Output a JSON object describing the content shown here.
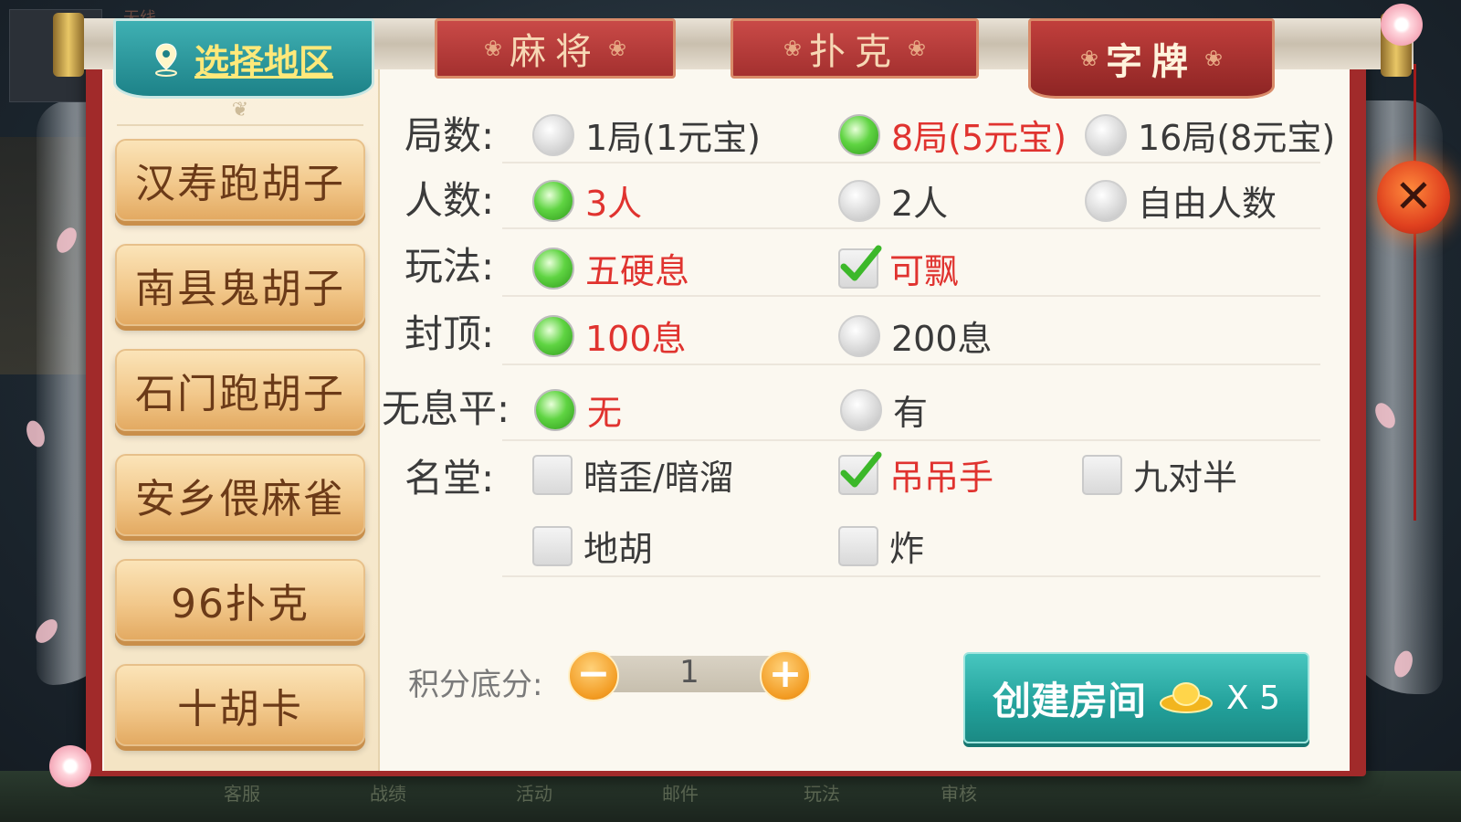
{
  "region": {
    "label": "选择地区"
  },
  "categories": [
    {
      "label": "麻将",
      "active": false
    },
    {
      "label": "扑克",
      "active": false
    },
    {
      "label": "字牌",
      "active": true
    }
  ],
  "sidebar": {
    "games": [
      "汉寿跑胡子",
      "南县鬼胡子",
      "石门跑胡子",
      "安乡偎麻雀",
      "96扑克",
      "十胡卡"
    ]
  },
  "options": {
    "rounds": {
      "label": "局数:",
      "choices": [
        "1局(1元宝)",
        "8局(5元宝)",
        "16局(8元宝)"
      ],
      "selected": "8局(5元宝)"
    },
    "players": {
      "label": "人数:",
      "choices": [
        "3人",
        "2人",
        "自由人数"
      ],
      "selected": "3人"
    },
    "play": {
      "label": "玩法:",
      "choices": [
        "五硬息",
        "可飘"
      ],
      "checked": [
        "五硬息",
        "可飘"
      ]
    },
    "cap": {
      "label": "封顶:",
      "choices": [
        "100息",
        "200息"
      ],
      "selected": "100息"
    },
    "noxi": {
      "label": "无息平:",
      "choices": [
        "无",
        "有"
      ],
      "selected": "无"
    },
    "hall": {
      "label": "名堂:",
      "choices": [
        "暗歪/暗溜",
        "吊吊手",
        "九对半",
        "地胡",
        "炸"
      ],
      "checked": [
        "吊吊手"
      ]
    }
  },
  "score": {
    "label": "积分底分:",
    "value": "1"
  },
  "create": {
    "label": "创建房间",
    "cost": "X 5"
  },
  "background": {
    "top_faded": "无线",
    "bottom_nav": [
      "客服",
      "战绩",
      "活动",
      "邮件",
      "玩法",
      "审核"
    ]
  },
  "colors": {
    "accent_red": "#e0332f",
    "teal": "#22a09a",
    "frame_red": "#a12a2a"
  }
}
